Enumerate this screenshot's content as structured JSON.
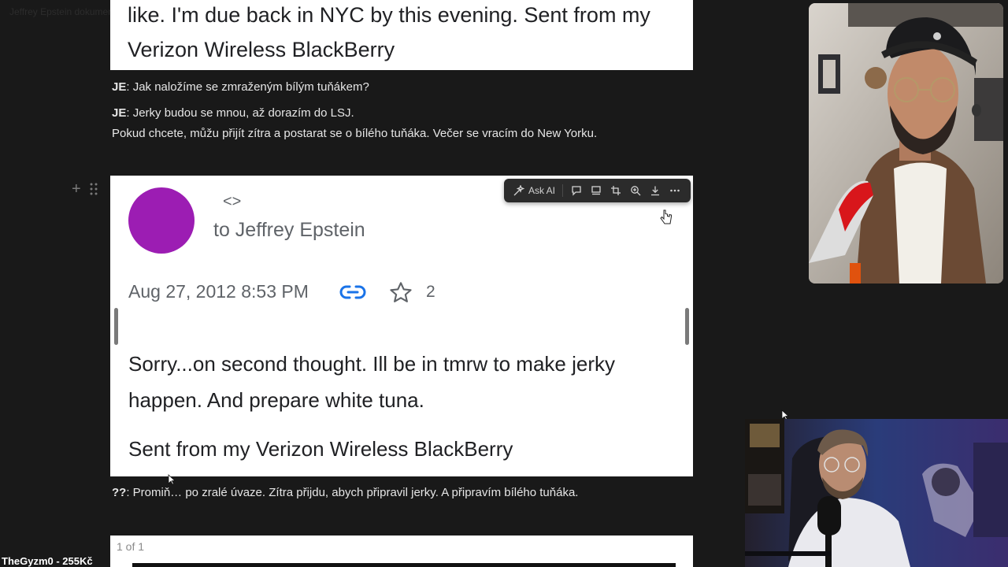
{
  "faint_header": "Jeffrey Epstein dokumenty",
  "email_top": {
    "line1": "like. I'm due back in NYC by this evening. Sent from my",
    "line2": "Verizon Wireless BlackBerry"
  },
  "translations": [
    {
      "speaker": "JE",
      "text": ": Jak naložíme se zmraženým bílým tuňákem?"
    },
    {
      "speaker": "JE",
      "text": ": Jerky budou se mnou, až dorazím do LSJ."
    },
    {
      "speaker": "",
      "text": "Pokud chcete, můžu přijít zítra a postarat se o bílého tuňáka. Večer se vracím do New Yorku."
    }
  ],
  "email_main": {
    "sender": "<>",
    "to_line": "to Jeffrey Epstein",
    "date": "Aug 27, 2012 8:53 PM",
    "star_count": "2",
    "body_line1": "Sorry...on second thought. Ill be in tmrw to make jerky",
    "body_line2": "happen. And prepare white tuna.",
    "signature": "Sent from my Verizon Wireless BlackBerry",
    "avatar_color": "#9c1db3"
  },
  "toolbar": {
    "ask_ai": "Ask AI",
    "buttons": [
      "comment-icon",
      "caption-icon",
      "crop-icon",
      "zoom-icon",
      "download-icon",
      "more-icon"
    ]
  },
  "translation2": {
    "speaker": "??",
    "text": ": Promiň… po zralé úvaze. Zítra přijdu, abych připravil jerky. A připravím bílého tuňáka."
  },
  "email_bottom": {
    "page_count": "1 of 1"
  },
  "channel_tag": "TheGyzm0 - 255Kč",
  "colors": {
    "background": "#191919",
    "page": "#ffffff",
    "link_blue": "#1a73e8"
  }
}
